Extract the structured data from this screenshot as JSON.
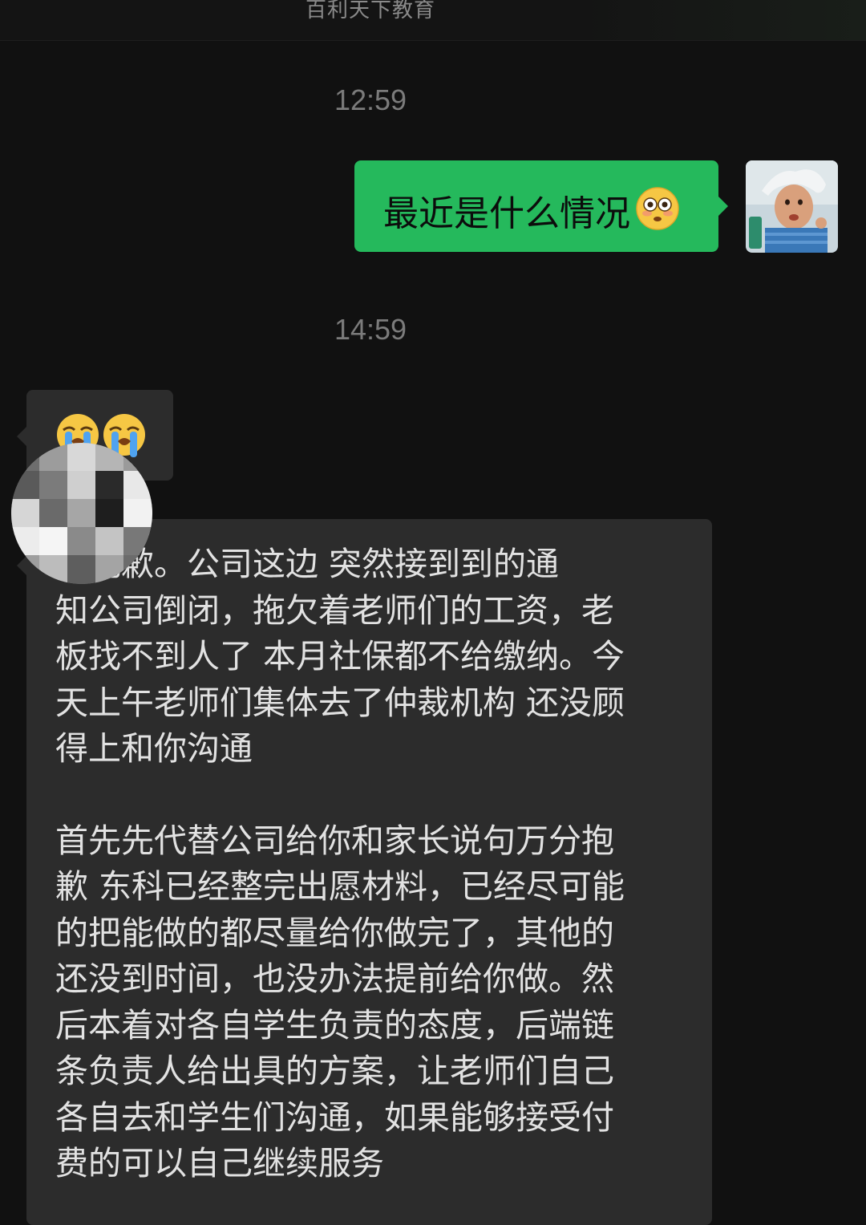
{
  "header": {
    "title": "百利天下教育"
  },
  "messages": {
    "timestamp_1": "12:59",
    "outgoing_text": "最近是什么情况",
    "outgoing_emoji": "flushed-face-emoji",
    "timestamp_2": "14:59",
    "incoming_emoji": [
      "loudly-crying-face-emoji",
      "loudly-crying-face-emoji"
    ],
    "incoming_para_1": "很抱歉。公司这边 突然接到到的通\n知公司倒闭，拖欠着老师们的工资，老\n板找不到人了 本月社保都不给缴纳。今\n天上午老师们集体去了仲裁机构 还没顾\n得上和你沟通",
    "incoming_para_2": "首先先代替公司给你和家长说句万分抱\n歉 东科已经整完出愿材料，已经尽可能\n的把能做的都尽量给你做完了，其他的\n还没到时间，也没办法提前给你做。然\n后本着对各自学生负责的态度，后端链\n条负责人给出具的方案，让老师们自己\n各自去和学生们沟通，如果能够接受付\n费的可以自己继续服务"
  },
  "colors": {
    "background": "#111111",
    "outgoing_bubble": "#25b95c",
    "incoming_bubble": "#2c2c2c"
  }
}
